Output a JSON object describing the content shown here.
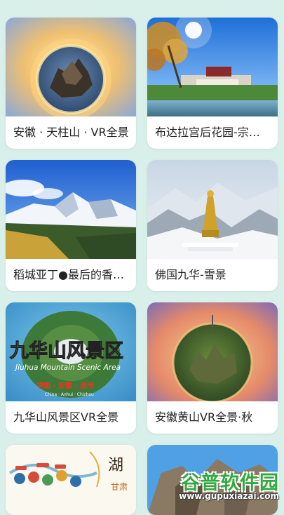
{
  "items": [
    {
      "title": "安徽 · 天柱山 · VR全景"
    },
    {
      "title": "布达拉宫后花园-宗角禄康"
    },
    {
      "title": "稻城亚丁●最后的香格里拉"
    },
    {
      "title": "佛国九华-雪景"
    },
    {
      "title": "九华山风景区VR全景",
      "image_text": {
        "title": "九华山风景区",
        "subtitle": "Jiuhua Mountain Scenic Area",
        "tag": "中国 · 安徽 · 池州",
        "tag_en": "China · Anhui · Chizhou"
      }
    },
    {
      "title": "安徽黄山VR全景·秋"
    },
    {
      "title": "",
      "image_text": {
        "a": "湖",
        "b": "甘肃"
      }
    },
    {
      "title": ""
    }
  ],
  "watermark": {
    "name": "谷普软件园",
    "url": "www.gupuxiazai.com"
  }
}
